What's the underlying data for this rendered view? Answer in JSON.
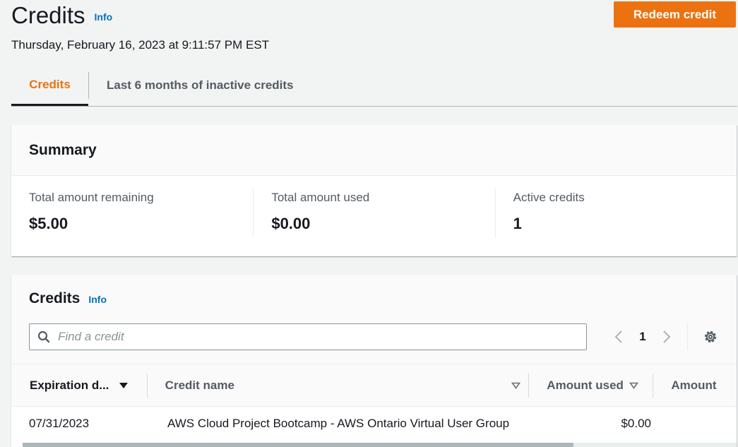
{
  "header": {
    "title": "Credits",
    "info_label": "Info",
    "timestamp": "Thursday, February 16, 2023 at 9:11:57 PM EST",
    "redeem_label": "Redeem credit"
  },
  "tabs": [
    {
      "label": "Credits",
      "active": true
    },
    {
      "label": "Last 6 months of inactive credits",
      "active": false
    }
  ],
  "summary": {
    "title": "Summary",
    "metrics": [
      {
        "label": "Total amount remaining",
        "value": "$5.00"
      },
      {
        "label": "Total amount used",
        "value": "$0.00"
      },
      {
        "label": "Active credits",
        "value": "1"
      }
    ]
  },
  "credits": {
    "title": "Credits",
    "info_label": "Info",
    "search_placeholder": "Find a credit",
    "page_number": "1",
    "columns": [
      {
        "label": "Expiration d...",
        "sort": "descending"
      },
      {
        "label": "Credit name",
        "sort": "none"
      },
      {
        "label": "Amount used",
        "sort": "none"
      },
      {
        "label": "Amount",
        "sort": "none"
      }
    ],
    "rows": [
      {
        "expiration": "07/31/2023",
        "name": "AWS Cloud Project Bootcamp - AWS Ontario Virtual User Group",
        "amount_used": "$0.00",
        "amount": ""
      }
    ]
  },
  "colors": {
    "accent": "#ec7211",
    "link": "#0073bb",
    "text": "#16191f",
    "background": "#f2f3f3"
  },
  "icons": [
    "search-icon",
    "chevron-left-icon",
    "chevron-right-icon",
    "gear-icon",
    "caret-down-filled-icon",
    "caret-down-outline-icon"
  ]
}
